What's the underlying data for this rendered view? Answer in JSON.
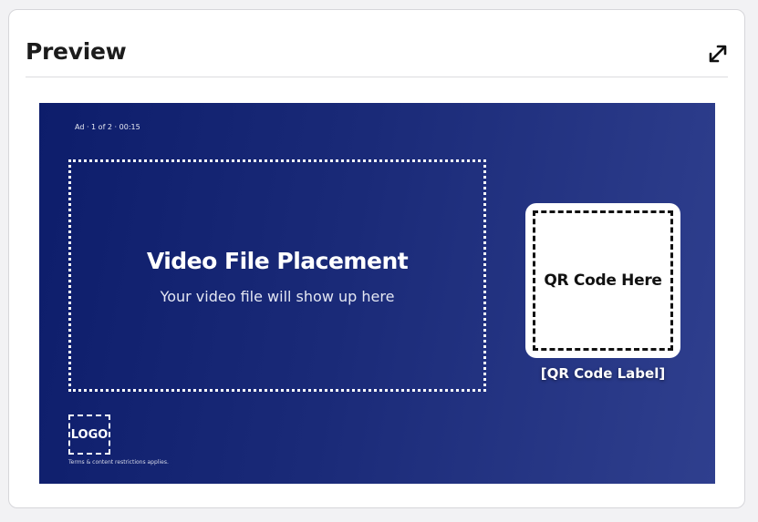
{
  "card": {
    "title": "Preview"
  },
  "icons": {
    "expand": "expand-arrows-icon"
  },
  "preview": {
    "ad_meta": "Ad · 1 of 2 · 00:15",
    "video": {
      "title": "Video File Placement",
      "subtitle": "Your video file will show up here"
    },
    "qr": {
      "placeholder": "QR Code Here",
      "label": "[QR Code Label]"
    },
    "logo": "LOGO",
    "terms": "Terms & content restrictions applies."
  },
  "colors": {
    "preview_bg_start": "#0d1d6b",
    "preview_bg_end": "#2f3f8e",
    "card_bg": "#ffffff",
    "page_bg": "#f2f2f4"
  }
}
